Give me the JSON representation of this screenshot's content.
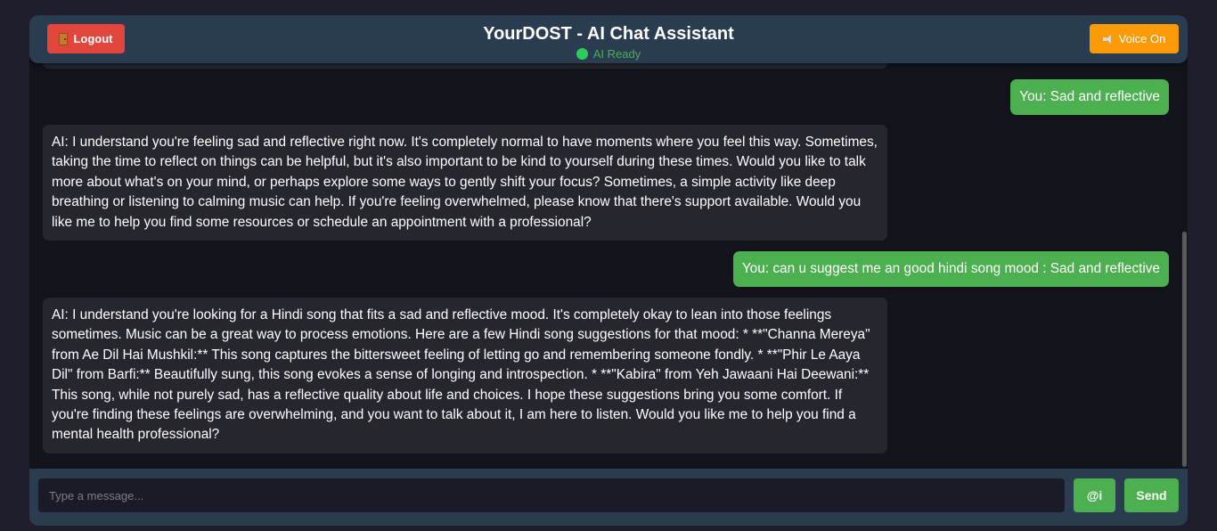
{
  "header": {
    "title": "YourDOST - AI Chat Assistant",
    "status": "AI Ready",
    "logout_label": "Logout",
    "logout_icon": "door-icon",
    "voice_label": "Voice On",
    "voice_icon": "speaker-icon"
  },
  "messages": [
    {
      "role": "user",
      "text": "You: Sad and reflective"
    },
    {
      "role": "ai",
      "text": "AI: I understand you're feeling sad and reflective right now. It's completely normal to have moments where you feel this way. Sometimes, taking the time to reflect on things can be helpful, but it's also important to be kind to yourself during these times. Would you like to talk more about what's on your mind, or perhaps explore some ways to gently shift your focus? Sometimes, a simple activity like deep breathing or listening to calming music can help. If you're feeling overwhelmed, please know that there's support available. Would you like me to help you find some resources or schedule an appointment with a professional?"
    },
    {
      "role": "user",
      "text": "You: can u suggest me an good hindi song mood : Sad and reflective"
    },
    {
      "role": "ai",
      "text": "AI: I understand you're looking for a Hindi song that fits a sad and reflective mood. It's completely okay to lean into those feelings sometimes. Music can be a great way to process emotions. Here are a few Hindi song suggestions for that mood: * **\"Channa Mereya\" from Ae Dil Hai Mushkil:** This song captures the bittersweet feeling of letting go and remembering someone fondly. * **\"Phir Le Aaya Dil\" from Barfi:** Beautifully sung, this song evokes a sense of longing and introspection. * **\"Kabira\" from Yeh Jawaani Hai Deewani:** This song, while not purely sad, has a reflective quality about life and choices. I hope these suggestions bring you some comfort. If you're finding these feelings are overwhelming, and you want to talk about it, I am here to listen. Would you like me to help you find a mental health professional?"
    }
  ],
  "composer": {
    "placeholder": "Type a message...",
    "at_label": "@i",
    "send_label": "Send"
  },
  "colors": {
    "user_bubble": "#4caf50",
    "ai_bubble": "#26262f",
    "header": "#2a3c4f",
    "logout": "#e2453c",
    "voice": "#fb9a07",
    "status": "#4caf50"
  }
}
